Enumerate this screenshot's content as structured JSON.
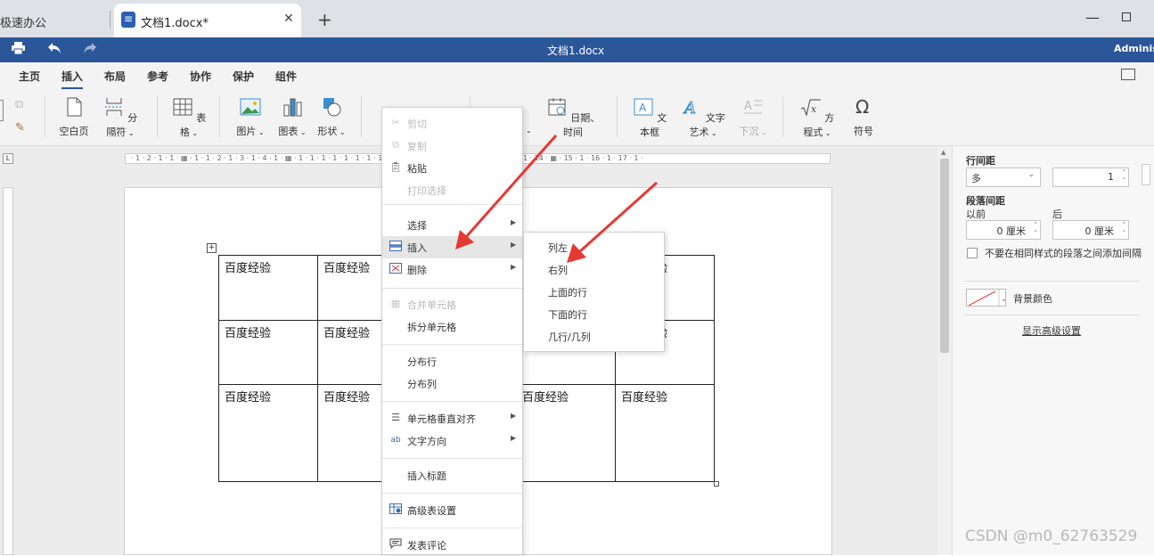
{
  "browser": {
    "inactive_tab": "极速办公",
    "active_tab": "文档1.docx*",
    "close_glyph": "✕",
    "new_tab_glyph": "+",
    "minimize_glyph": "—"
  },
  "titlebar": {
    "title": "文档1.docx",
    "user": "Administ"
  },
  "menu_tabs": [
    "主页",
    "插入",
    "布局",
    "参考",
    "协作",
    "保护",
    "组件"
  ],
  "ribbon": {
    "blank_page": "空白页",
    "page_break": "分隔符",
    "table": "表格",
    "image": "图片",
    "chart": "图表",
    "shape": "形状",
    "datetime": "日期、时间",
    "textbox": "文本框",
    "wordart": "文字艺术",
    "dropcap": "下沉",
    "equation": "方程式",
    "symbol": "符号"
  },
  "ruler": {
    "text": "· 1 · 2 · 1 · 1 · ▦ · 1 · 1 · 2 · 1 · 3 · 1 · 4 · 1 · ▦ · 1 · 1 · 1 · 1 · 1 · 1 · 1 · 1 · 1 · 9 · 1 · 10 · 1 · 11 · ▦ · 12 · 1 · 13 · 1 · 14 · ▦ · 15 · 1 · 16 · 1 · 17 · 1 ·",
    "corner": "L"
  },
  "table": {
    "cell_text": "百度经验",
    "move_glyph": "+"
  },
  "context_menu": {
    "cut": "剪切",
    "copy": "复制",
    "paste": "粘贴",
    "print_selection": "打印选择",
    "select": "选择",
    "insert": "插入",
    "delete": "删除",
    "merge_cells": "合并单元格",
    "split_cells": "拆分单元格",
    "distribute_rows": "分布行",
    "distribute_cols": "分布列",
    "vertical_align": "单元格垂直对齐",
    "text_direction": "文字方向",
    "insert_caption": "插入标题",
    "advanced_table": "高级表设置",
    "add_comment": "发表评论"
  },
  "submenu": {
    "col_left": "列左",
    "col_right": "右列",
    "row_above": "上面的行",
    "row_below": "下面的行",
    "rows_cols": "几行/几列"
  },
  "right_panel": {
    "line_spacing_label": "行间距",
    "line_spacing_type": "多",
    "line_spacing_value": "1",
    "para_spacing_label": "段落间距",
    "before_label": "以前",
    "after_label": "后",
    "before_value": "0 厘米",
    "after_value": "0 厘米",
    "no_space_checkbox_label": "不要在相同样式的段落之间添加间隔",
    "bg_color_label": "背景颜色",
    "show_advanced": "显示高级设置"
  },
  "colors": {
    "accent_blue": "#2b579a",
    "annotation_red": "#e53935"
  },
  "watermark": "CSDN @m0_62763529"
}
